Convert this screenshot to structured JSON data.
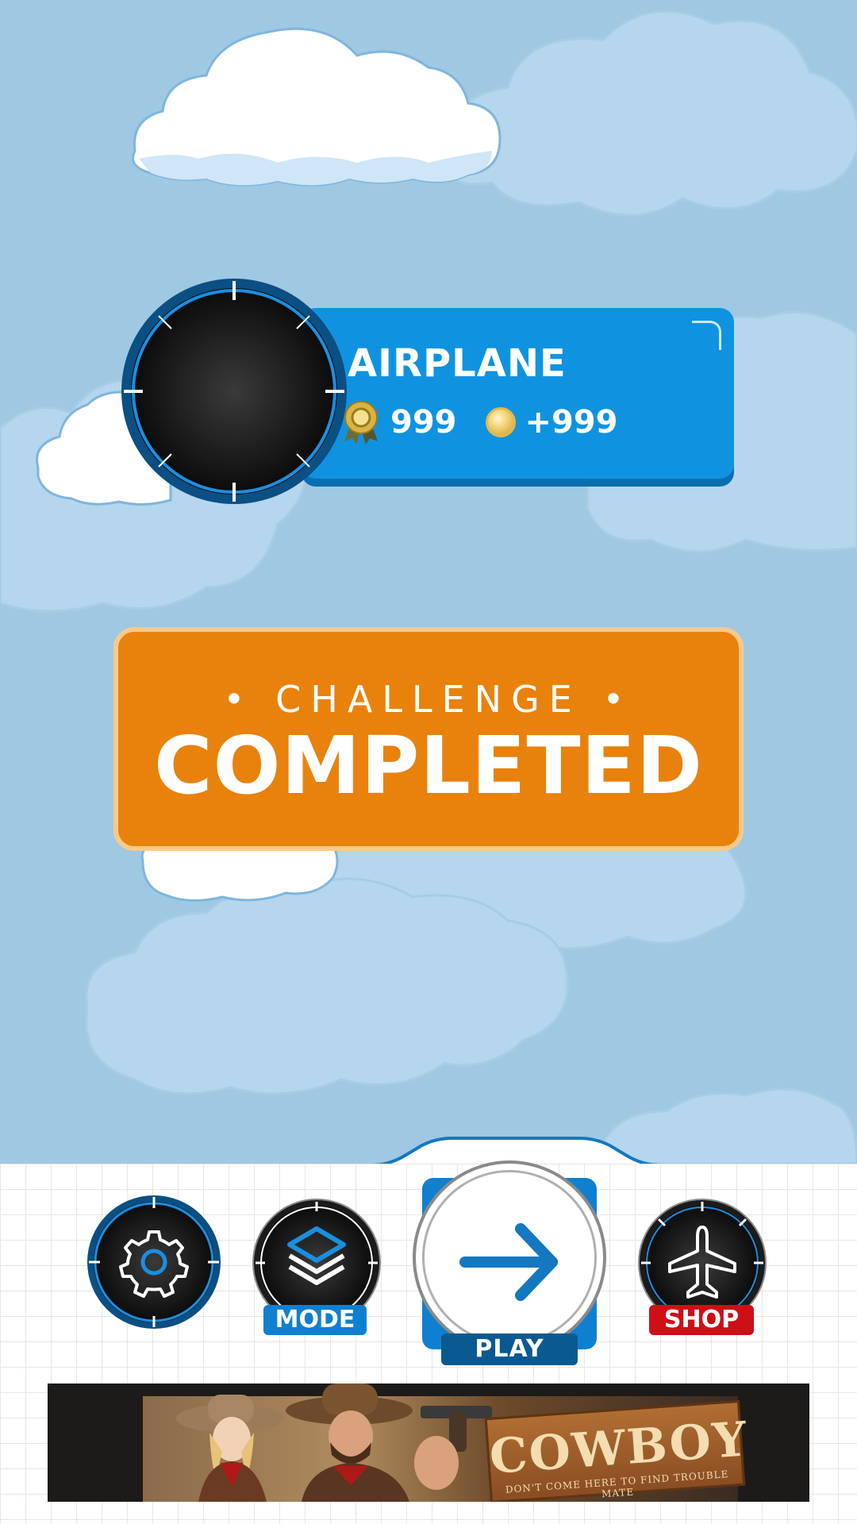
{
  "player": {
    "name": "AIRPLANE",
    "medals": "999",
    "coins": "+999"
  },
  "challenge": {
    "subtitle": "• CHALLENGE •",
    "title": "COMPLETED"
  },
  "nav": {
    "settings_icon": "gear-icon",
    "mode_label": "MODE",
    "mode_icon": "layers-icon",
    "play_label": "PLAY",
    "play_icon": "arrow-right-icon",
    "shop_label": "SHOP",
    "shop_icon": "airplane-icon"
  },
  "ad": {
    "title": "COWBOY",
    "tagline": "DON'T COME HERE TO FIND TROUBLE MATE"
  },
  "colors": {
    "sky": "#9fc8e3",
    "panel_blue": "#0f93e1",
    "challenge_orange": "#e8820c",
    "mode_blue": "#0f80d0",
    "shop_red": "#cc1016",
    "play_label": "#0a5a91"
  }
}
